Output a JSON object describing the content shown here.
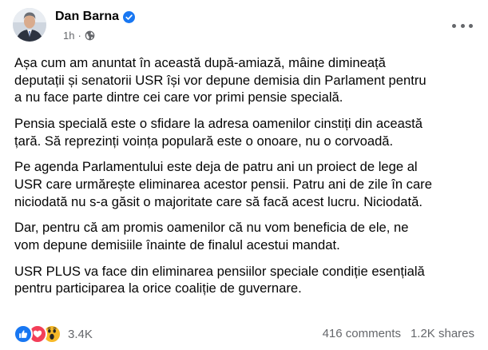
{
  "post": {
    "author": "Dan Barna",
    "time": "1h",
    "separator": "·",
    "paragraphs": [
      "Așa cum am anuntat în această după-amiază, mâine dimineață\ndeputații și senatorii USR își vor depune demisia din Parlament pentru\na nu face parte dintre cei care vor primi pensie specială.",
      "Pensia specială este o sfidare la adresa oamenilor cinstiți din această\nțară. Să reprezinți voința populară este o onoare, nu o corvoadă.",
      "Pe agenda Parlamentului este deja de patru ani un proiect de lege al\nUSR care urmărește eliminarea acestor pensii. Patru ani de zile în care\nniciodată nu s-a găsit o majoritate care să facă acest lucru. Niciodată.",
      "Dar, pentru că am promis oamenilor că nu vom beneficia de ele, ne\nvom depune demisiile înainte de finalul acestui mandat.",
      "USR PLUS va face din eliminarea pensiilor speciale condiție esențială\npentru participarea la orice coaliție de guvernare."
    ]
  },
  "footer": {
    "reactions": [
      "like-icon",
      "love-icon",
      "wow-icon"
    ],
    "reaction_count": "3.4K",
    "comments": "416 comments",
    "shares": "1.2K shares"
  },
  "colors": {
    "verified": "#1877f2",
    "like": "#1877f2",
    "love": "#f33e58",
    "wow": "#f7b928",
    "secondary_text": "#65676b"
  }
}
